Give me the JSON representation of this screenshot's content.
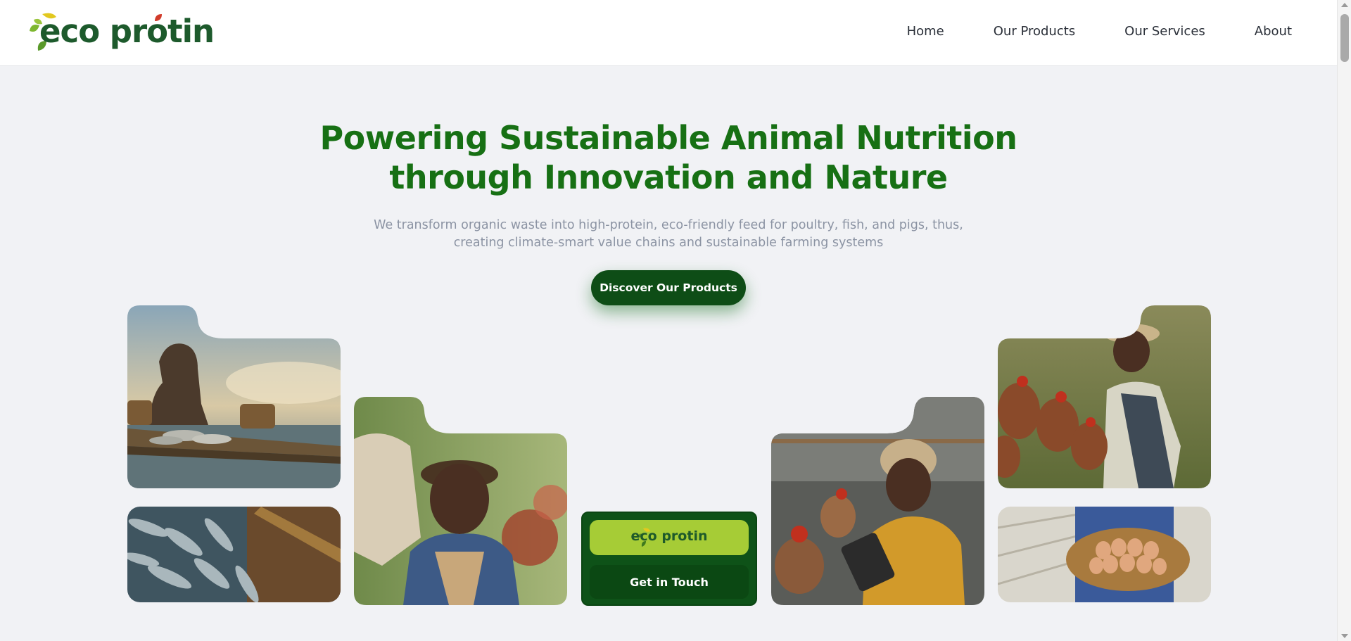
{
  "brand": {
    "name": "eco protin"
  },
  "nav": {
    "items": [
      {
        "label": "Home"
      },
      {
        "label": "Our Products"
      },
      {
        "label": "Our Services"
      },
      {
        "label": "About"
      }
    ]
  },
  "hero": {
    "title_line1": "Powering Sustainable Animal Nutrition",
    "title_line2": "through Innovation and Nature",
    "subtitle_line1": "We transform organic waste into high-protein, eco-friendly feed for poultry, fish, and pigs, thus,",
    "subtitle_line2": "creating climate-smart value chains and sustainable farming systems",
    "cta_label": "Discover Our Products"
  },
  "center_card": {
    "logo_text": "eco protin",
    "button_label": "Get in Touch"
  },
  "photos": [
    {
      "name": "fisherman-raft-photo"
    },
    {
      "name": "fish-catch-photo"
    },
    {
      "name": "farmer-sack-photo"
    },
    {
      "name": "woman-tablet-chickens-photo"
    },
    {
      "name": "woman-chickens-field-photo"
    },
    {
      "name": "egg-basket-photo"
    }
  ],
  "colors": {
    "brand_green": "#177014",
    "dark_green": "#0e4d16",
    "lime": "#a6cc36",
    "subtitle_gray": "#8b93a3",
    "background": "#f1f2f5"
  }
}
